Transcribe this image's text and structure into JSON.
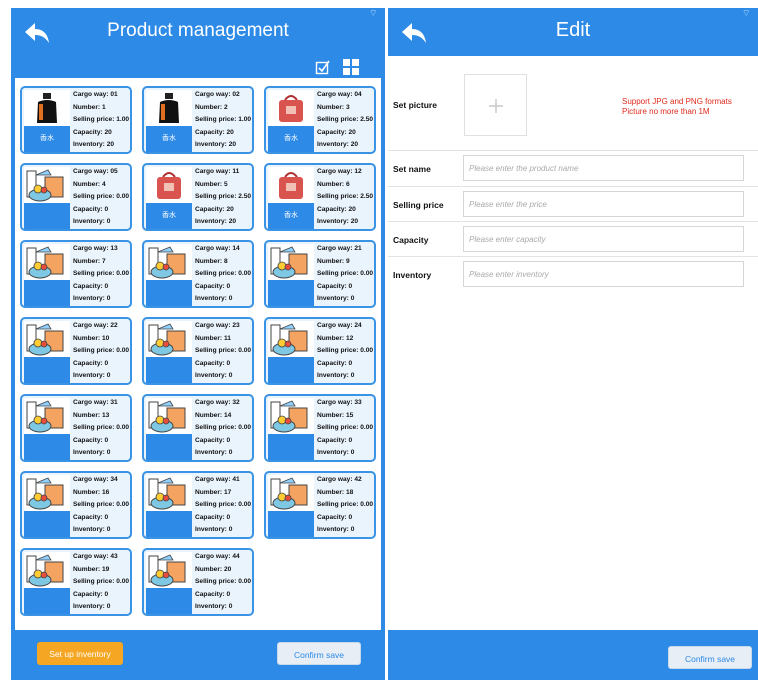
{
  "left": {
    "title": "Product management",
    "back_icon": "back-arrow-icon",
    "toolbar": {
      "select_icon": "check-square-icon",
      "grid_icon": "grid-icon"
    },
    "labels": {
      "cargo": "Cargo way: ",
      "number": "Number: ",
      "price": "Selling price: ",
      "capacity": "Capacity: ",
      "inventory": "Inventory: "
    },
    "cards": [
      {
        "cargo": "01",
        "number": "1",
        "price": "1.00",
        "capacity": "20",
        "inventory": "20",
        "image": "perfume-bottle",
        "tag": "香水"
      },
      {
        "cargo": "02",
        "number": "2",
        "price": "1.00",
        "capacity": "20",
        "inventory": "20",
        "image": "perfume-bottle",
        "tag": "香水"
      },
      {
        "cargo": "04",
        "number": "3",
        "price": "2.50",
        "capacity": "20",
        "inventory": "20",
        "image": "red-bag",
        "tag": "香水"
      },
      {
        "cargo": "05",
        "number": "4",
        "price": "0.00",
        "capacity": "0",
        "inventory": "0",
        "image": "grocery",
        "tag": ""
      },
      {
        "cargo": "11",
        "number": "5",
        "price": "2.50",
        "capacity": "20",
        "inventory": "20",
        "image": "red-bag",
        "tag": "香水"
      },
      {
        "cargo": "12",
        "number": "6",
        "price": "2.50",
        "capacity": "20",
        "inventory": "20",
        "image": "red-bag",
        "tag": "香水"
      },
      {
        "cargo": "13",
        "number": "7",
        "price": "0.00",
        "capacity": "0",
        "inventory": "0",
        "image": "grocery",
        "tag": ""
      },
      {
        "cargo": "14",
        "number": "8",
        "price": "0.00",
        "capacity": "0",
        "inventory": "0",
        "image": "grocery",
        "tag": ""
      },
      {
        "cargo": "21",
        "number": "9",
        "price": "0.00",
        "capacity": "0",
        "inventory": "0",
        "image": "grocery",
        "tag": ""
      },
      {
        "cargo": "22",
        "number": "10",
        "price": "0.00",
        "capacity": "0",
        "inventory": "0",
        "image": "grocery",
        "tag": ""
      },
      {
        "cargo": "23",
        "number": "11",
        "price": "0.00",
        "capacity": "0",
        "inventory": "0",
        "image": "grocery",
        "tag": ""
      },
      {
        "cargo": "24",
        "number": "12",
        "price": "0.00",
        "capacity": "0",
        "inventory": "0",
        "image": "grocery",
        "tag": ""
      },
      {
        "cargo": "31",
        "number": "13",
        "price": "0.00",
        "capacity": "0",
        "inventory": "0",
        "image": "grocery",
        "tag": ""
      },
      {
        "cargo": "32",
        "number": "14",
        "price": "0.00",
        "capacity": "0",
        "inventory": "0",
        "image": "grocery",
        "tag": ""
      },
      {
        "cargo": "33",
        "number": "15",
        "price": "0.00",
        "capacity": "0",
        "inventory": "0",
        "image": "grocery",
        "tag": ""
      },
      {
        "cargo": "34",
        "number": "16",
        "price": "0.00",
        "capacity": "0",
        "inventory": "0",
        "image": "grocery",
        "tag": ""
      },
      {
        "cargo": "41",
        "number": "17",
        "price": "0.00",
        "capacity": "0",
        "inventory": "0",
        "image": "grocery",
        "tag": ""
      },
      {
        "cargo": "42",
        "number": "18",
        "price": "0.00",
        "capacity": "0",
        "inventory": "0",
        "image": "grocery",
        "tag": ""
      },
      {
        "cargo": "43",
        "number": "19",
        "price": "0.00",
        "capacity": "0",
        "inventory": "0",
        "image": "grocery",
        "tag": ""
      },
      {
        "cargo": "44",
        "number": "20",
        "price": "0.00",
        "capacity": "0",
        "inventory": "0",
        "image": "grocery",
        "tag": ""
      }
    ],
    "setup_inventory_label": "Set up inventory",
    "confirm_save_label": "Confirm save"
  },
  "right": {
    "title": "Edit",
    "back_icon": "back-arrow-icon",
    "set_picture_label": "Set picture",
    "picture_hint_1": "Support JPG and PNG formats",
    "picture_hint_2": "Picture no more than 1M",
    "add_icon": "plus-icon",
    "fields": [
      {
        "label": "Set name",
        "placeholder": "Please enter the product name"
      },
      {
        "label": "Selling price",
        "placeholder": "Please enter the price"
      },
      {
        "label": "Capacity",
        "placeholder": "Please enter capacity"
      },
      {
        "label": "Inventory",
        "placeholder": "Please enter inventory"
      }
    ],
    "confirm_save_label": "Confirm save"
  },
  "colors": {
    "primary": "#2d8ae6",
    "accent_orange": "#f5a623",
    "hint_red": "#e02a1b",
    "card_bg": "#eaf4fd"
  }
}
